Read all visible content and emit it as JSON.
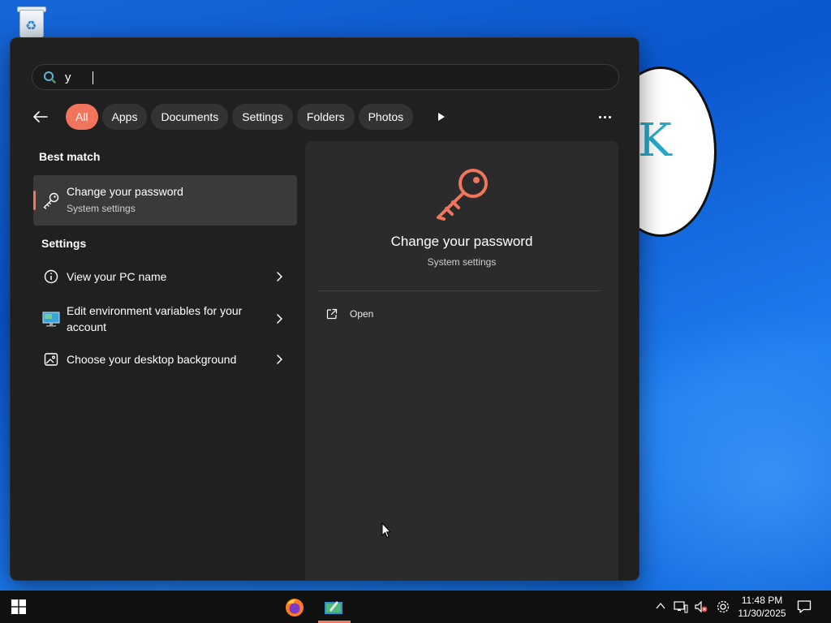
{
  "search": {
    "value": "y",
    "placeholder": ""
  },
  "filters": {
    "chips": [
      {
        "label": "All",
        "active": true
      },
      {
        "label": "Apps",
        "active": false
      },
      {
        "label": "Documents",
        "active": false
      },
      {
        "label": "Settings",
        "active": false
      },
      {
        "label": "Folders",
        "active": false
      },
      {
        "label": "Photos",
        "active": false
      }
    ]
  },
  "results": {
    "best_match_heading": "Best match",
    "best_match": {
      "title": "Change your password",
      "subtitle": "System settings",
      "icon": "key-icon"
    },
    "settings_heading": "Settings",
    "settings_items": [
      {
        "label": "View your PC name",
        "icon": "info-icon"
      },
      {
        "label": "Edit environment variables for your account",
        "icon": "monitor-icon"
      },
      {
        "label": "Choose your desktop background",
        "icon": "picture-icon"
      }
    ]
  },
  "details": {
    "title": "Change your password",
    "subtitle": "System settings",
    "actions": [
      {
        "label": "Open",
        "icon": "open-external-icon"
      }
    ]
  },
  "taskbar": {
    "apps": [
      {
        "name": "Firefox",
        "icon": "firefox-icon"
      },
      {
        "name": "App",
        "icon": "app-icon",
        "active": true
      }
    ],
    "clock": {
      "time": "11:48 PM",
      "date": "11/30/2025"
    }
  },
  "colors": {
    "accent": "#f0755c",
    "panel_bg": "#202020",
    "details_bg": "#2b2b2b",
    "taskbar_bg": "#101010"
  }
}
